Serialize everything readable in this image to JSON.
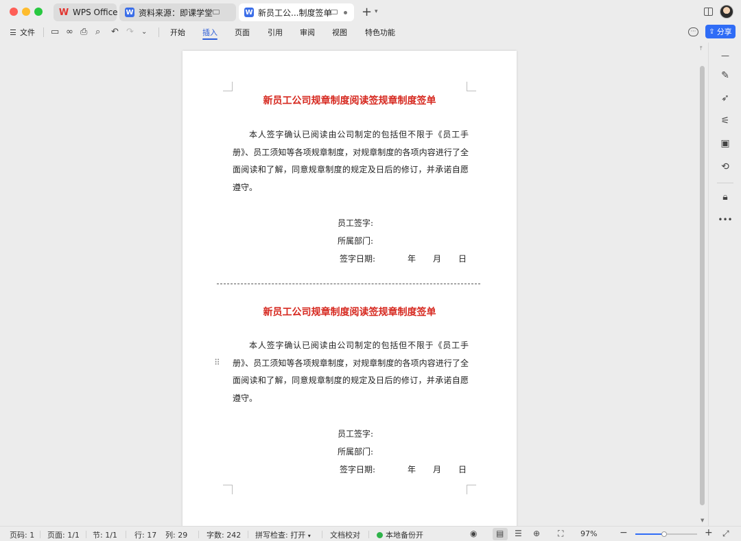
{
  "tabs": [
    {
      "label": "WPS Office",
      "icon": "wps-logo-icon"
    },
    {
      "label": "资料来源：即课学堂",
      "icon": "writer-doc-icon"
    },
    {
      "label": "新员工公...制度签单",
      "icon": "writer-doc-icon",
      "active": true
    }
  ],
  "menu": {
    "file_label": "文件",
    "tabs": [
      "开始",
      "插入",
      "页面",
      "引用",
      "审阅",
      "视图",
      "特色功能"
    ],
    "active_tab": "插入",
    "share_label": "分享"
  },
  "document": {
    "sections": [
      {
        "title": "新员工公司规章制度阅读签规章制度签单",
        "body": "本人签字确认已阅读由公司制定的包括但不限于《员工手册》、员工须知等各项规章制度，对规章制度的各项内容进行了全面阅读和了解，同意规章制度的规定及日后的修订，并承诺自愿遵守。",
        "signature_label": "员工签字:",
        "department_label": "所属部门:",
        "date_label": "签字日期:",
        "year": "年",
        "month": "月",
        "day": "日"
      },
      {
        "title": "新员工公司规章制度阅读签规章制度签单",
        "body": "本人签字确认已阅读由公司制定的包括但不限于《员工手册》、员工须知等各项规章制度，对规章制度的各项内容进行了全面阅读和了解，同意规章制度的规定及日后的修订，并承诺自愿遵守。",
        "signature_label": "员工签字:",
        "department_label": "所属部门:",
        "date_label": "签字日期:",
        "year": "年",
        "month": "月",
        "day": "日"
      }
    ]
  },
  "status": {
    "page_num": "页码: 1",
    "pages": "页面: 1/1",
    "section": "节: 1/1",
    "row": "行: 17",
    "col": "列: 29",
    "word_count": "字数: 242",
    "spell_check": "拼写检查: 打开",
    "doc_proof": "文档校对",
    "backup": "本地备份开",
    "zoom": "97%",
    "zoom_level": 0.47
  },
  "colors": {
    "accent": "#2f6cf6",
    "title_red": "#d6281f",
    "backup_green": "#2fb34a"
  }
}
